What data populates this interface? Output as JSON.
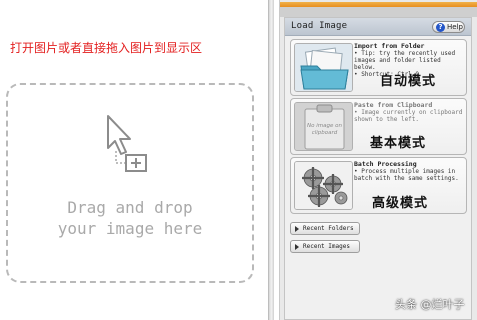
{
  "left": {
    "hint": "打开图片或者直接拖入图片到显示区",
    "drop_line1": "Drag and drop",
    "drop_line2": "your image here"
  },
  "panel": {
    "title": "Load Image",
    "help_label": "Help",
    "options": [
      {
        "title": "Import from Folder",
        "desc": [
          "• Tip: try the recently used",
          "images and folder listed",
          "below.",
          "• Shortcut: Ctrl-O"
        ],
        "mode": "自动模式",
        "icon": "folder-icon"
      },
      {
        "title": "Paste from Clipboard",
        "desc": [
          "• Image currently on clipboard",
          "shown to the left."
        ],
        "mode": "基本模式",
        "icon": "clipboard-icon",
        "thumb_text": [
          "No image on",
          "clipboard"
        ]
      },
      {
        "title": "Batch Processing",
        "desc": [
          "• Process multiple images in",
          "batch with the same settings."
        ],
        "mode": "高级模式",
        "icon": "gears-icon"
      }
    ],
    "recent_folders": "Recent Folders",
    "recent_images": "Recent Images"
  },
  "watermark": "头条 @烂叶子"
}
